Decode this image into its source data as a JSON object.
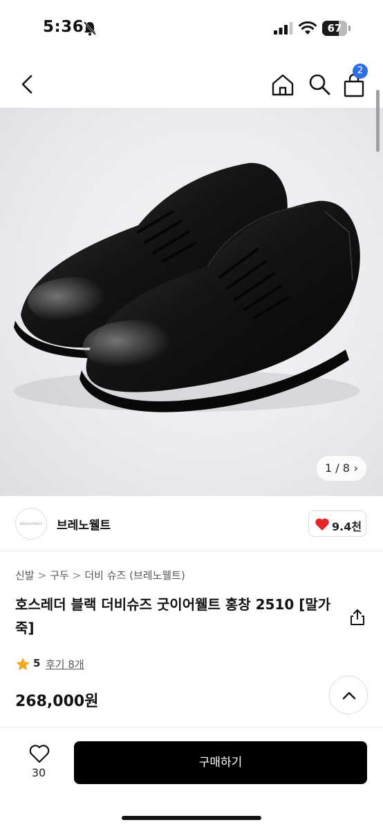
{
  "status_bar": {
    "time": "5:36",
    "battery_level": "67",
    "battery_fraction": 0.67
  },
  "nav": {
    "back_icon": "chevron-left-icon",
    "home_icon": "home-icon",
    "search_icon": "search-icon",
    "cart_icon": "shopping-bag-icon",
    "cart_badge": "2",
    "badge_color": "#2f6fe4"
  },
  "gallery": {
    "counter": "1 / 8",
    "counter_chevron": "›"
  },
  "seller": {
    "name": "브레노웰트",
    "logo_text": "BRENOWELT",
    "likes": "9.4천",
    "like_color": "#e5252a"
  },
  "breadcrumb": [
    "신발",
    "구두",
    "더비 슈즈 (브레노웰트)"
  ],
  "breadcrumb_separator": ">",
  "product": {
    "title": "호스레더 블랙 더비슈즈 굿이어웰트 홍창 2510 [말가죽]",
    "rating": "5",
    "reviews": "후기 8개",
    "price": "268,000원",
    "star_color": "#f5a623"
  },
  "bottom_bar": {
    "wish_count": "30",
    "buy_label": "구매하기"
  }
}
